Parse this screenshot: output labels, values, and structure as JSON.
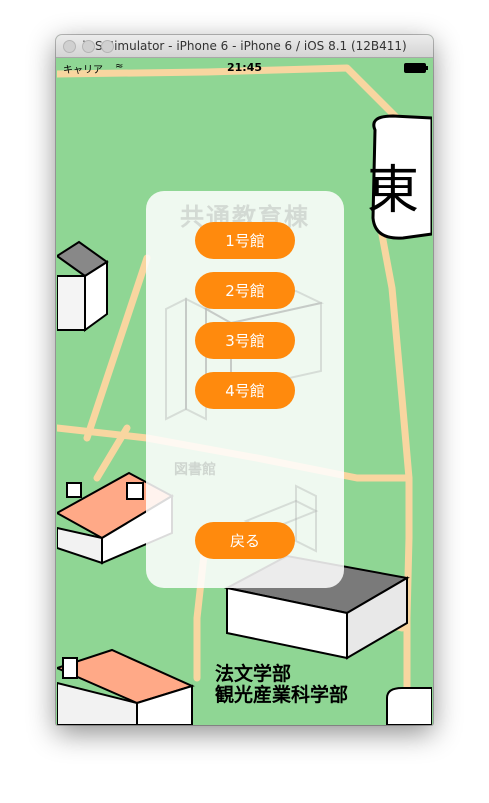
{
  "window": {
    "title": "iOS Simulator - iPhone 6 - iPhone 6 / iOS 8.1 (12B411)"
  },
  "status_bar": {
    "carrier": "キャリア",
    "wifi_icon": "wifi-icon",
    "time": "21:45",
    "battery_icon": "battery-icon"
  },
  "map": {
    "east_marker": "東",
    "faculty_label_line1": "法文学部",
    "faculty_label_line2": "観光産業科学部"
  },
  "panel": {
    "title": "共通教育棟",
    "sub_label": "図書館",
    "buttons": [
      {
        "label": "1号館"
      },
      {
        "label": "2号館"
      },
      {
        "label": "3号館"
      },
      {
        "label": "4号館"
      }
    ],
    "back_label": "戻る"
  },
  "colors": {
    "map_green": "#8fd694",
    "road": "#f8d6a0",
    "button_orange": "#ff8a0d",
    "roof_salmon": "#ffa987"
  }
}
